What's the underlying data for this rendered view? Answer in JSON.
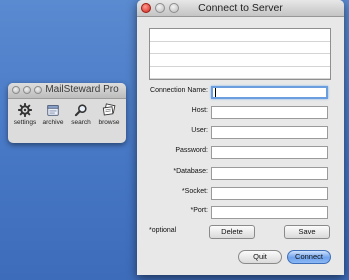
{
  "palette": {
    "title": "MailSteward Pro",
    "tools": [
      {
        "label": "settings",
        "icon": "gear-icon"
      },
      {
        "label": "archive",
        "icon": "archive-icon"
      },
      {
        "label": "search",
        "icon": "magnifier-icon"
      },
      {
        "label": "browse",
        "icon": "browse-icon"
      }
    ]
  },
  "dialog": {
    "title": "Connect to Server",
    "fields": [
      {
        "label": "Connection Name:",
        "value": ""
      },
      {
        "label": "Host:",
        "value": ""
      },
      {
        "label": "User:",
        "value": ""
      },
      {
        "label": "Password:",
        "value": ""
      },
      {
        "label": "*Database:",
        "value": ""
      },
      {
        "label": "*Socket:",
        "value": ""
      },
      {
        "label": "*Port:",
        "value": ""
      }
    ],
    "optional_note": "*optional",
    "delete_label": "Delete",
    "save_label": "Save",
    "quit_label": "Quit",
    "connect_label": "Connect"
  },
  "colors": {
    "desktop": "#4a7ac6",
    "default_button": "#6fa3ee",
    "focus_ring": "#6a9ede",
    "close_light": "#d0221a"
  }
}
